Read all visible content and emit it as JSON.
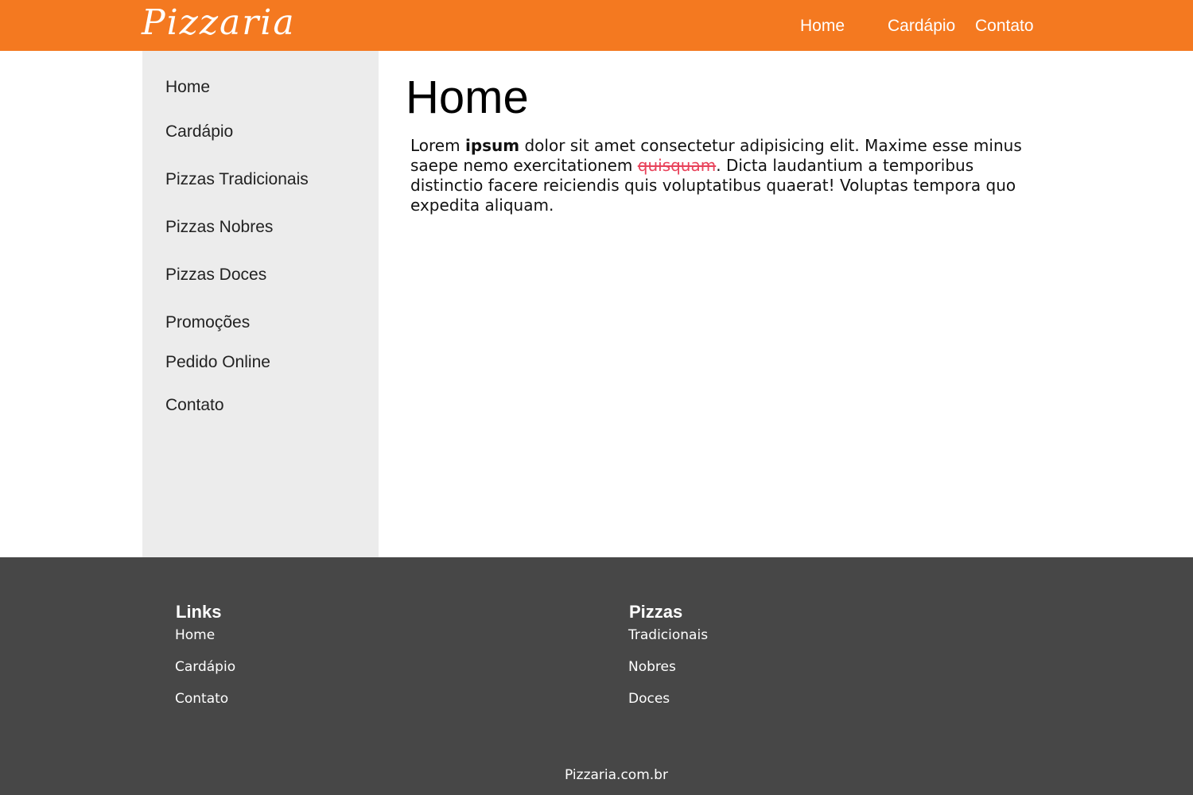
{
  "header": {
    "logo": "Pizzaria",
    "nav": [
      "Home",
      "Cardápio",
      "Contato"
    ]
  },
  "sidebar": {
    "items": [
      {
        "label": "Home"
      },
      {
        "label": "Cardápio"
      },
      {
        "label": "Pizzas Tradicionais"
      },
      {
        "label": "Pizzas Nobres"
      },
      {
        "label": "Pizzas Doces"
      },
      {
        "label": "Promoções"
      },
      {
        "label": "Pedido Online"
      },
      {
        "label": "Contato"
      }
    ]
  },
  "main": {
    "title": "Home",
    "paragraph": {
      "part1": "Lorem ",
      "bold": "ipsum",
      "part2": " dolor sit amet consectetur adipisicing elit. Maxime esse minus saepe nemo exercitationem ",
      "strike": "quisquam",
      "part3": ". Dicta laudantium a temporibus distinctio facere reiciendis quis voluptatibus quaerat! Voluptas tempora quo expedita aliquam."
    }
  },
  "footer": {
    "links": {
      "heading": "Links",
      "items": [
        "Home",
        "Cardápio",
        "Contato"
      ]
    },
    "pizzas": {
      "heading": "Pizzas",
      "items": [
        "Tradicionais",
        "Nobres",
        "Doces"
      ]
    },
    "copyright": "Pizzaria.com.br"
  },
  "colors": {
    "header_bg": "#f47920",
    "sidebar_bg": "#ececec",
    "footer_bg": "#474747",
    "strike_text": "#e8425a"
  }
}
